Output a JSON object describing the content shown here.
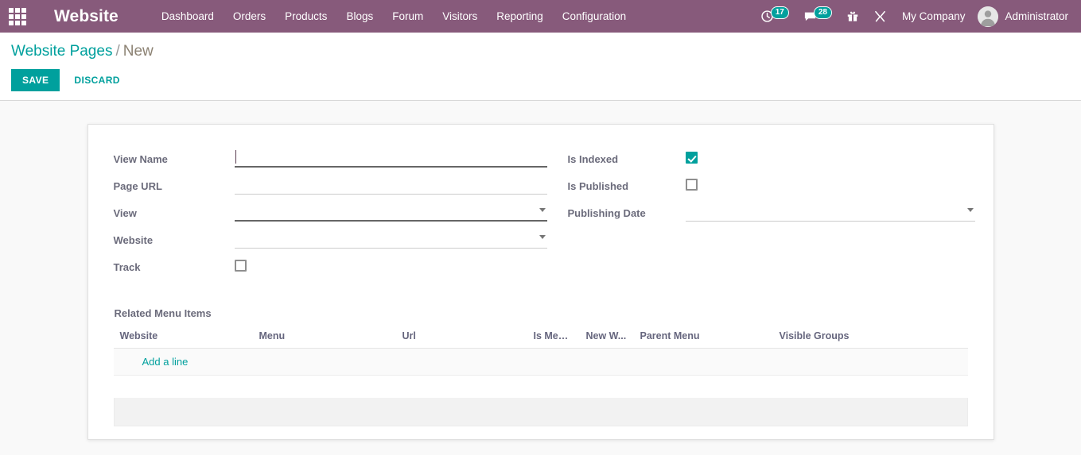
{
  "navbar": {
    "apps_icon": "apps-grid-icon",
    "brand": "Website",
    "menu": [
      {
        "label": "Dashboard"
      },
      {
        "label": "Orders"
      },
      {
        "label": "Products"
      },
      {
        "label": "Blogs"
      },
      {
        "label": "Forum"
      },
      {
        "label": "Visitors"
      },
      {
        "label": "Reporting"
      },
      {
        "label": "Configuration"
      }
    ],
    "systray": {
      "activities": {
        "icon": "activity-clock-icon",
        "count": "17"
      },
      "messages": {
        "icon": "messages-chat-icon",
        "count": "28"
      },
      "gift": {
        "icon": "gift-icon"
      },
      "tools": {
        "icon": "tools-wrench-icon"
      },
      "company": "My Company",
      "user": "Administrator",
      "avatar_icon": "user-avatar-icon"
    },
    "colors": {
      "background": "#875A7B",
      "badge": "#00A09D",
      "text": "#ffffff"
    }
  },
  "control_panel": {
    "breadcrumb": {
      "parent": "Website Pages",
      "separator": "/",
      "current": "New"
    },
    "save_label": "SAVE",
    "discard_label": "DISCARD",
    "accent": "#00A09D"
  },
  "form": {
    "left_fields": [
      {
        "label": "View Name",
        "type": "text",
        "value": "",
        "placeholder": "",
        "underline": "dark",
        "focused": true
      },
      {
        "label": "Page URL",
        "type": "text",
        "value": "",
        "placeholder": "",
        "underline": "light",
        "focused": false
      },
      {
        "label": "View",
        "type": "select",
        "value": "",
        "placeholder": "",
        "underline": "dark",
        "focused": false
      },
      {
        "label": "Website",
        "type": "select",
        "value": "",
        "placeholder": "",
        "underline": "light",
        "focused": false
      },
      {
        "label": "Track",
        "type": "checkbox",
        "checked": false
      }
    ],
    "right_fields": [
      {
        "label": "Is Indexed",
        "type": "checkbox",
        "checked": true
      },
      {
        "label": "Is Published",
        "type": "checkbox",
        "checked": false
      },
      {
        "label": "Publishing Date",
        "type": "select",
        "value": "",
        "placeholder": "",
        "underline": "light",
        "focused": false
      }
    ]
  },
  "related_menu_items": {
    "title": "Related Menu Items",
    "columns": [
      "Website",
      "Menu",
      "Url",
      "Is Mega ...",
      "New W...",
      "Parent Menu",
      "Visible Groups"
    ],
    "rows": [],
    "add_line_label": "Add a line"
  }
}
